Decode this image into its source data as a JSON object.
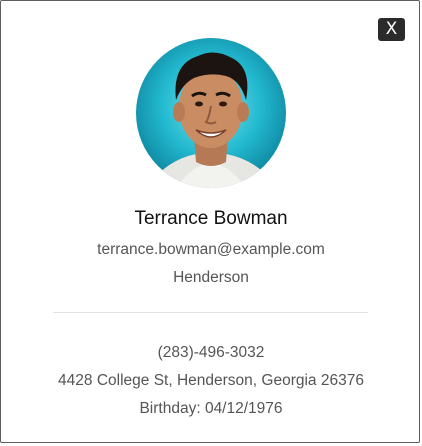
{
  "modal": {
    "close_label": "X"
  },
  "profile": {
    "name": "Terrance Bowman",
    "email": "terrance.bowman@example.com",
    "city": "Henderson",
    "phone": "(283)-496-3032",
    "address": "4428 College St, Henderson, Georgia 26376",
    "birthday": "Birthday: 04/12/1976"
  },
  "colors": {
    "avatar_background": "#1ab0c8",
    "close_button": "#2b2b2b"
  }
}
